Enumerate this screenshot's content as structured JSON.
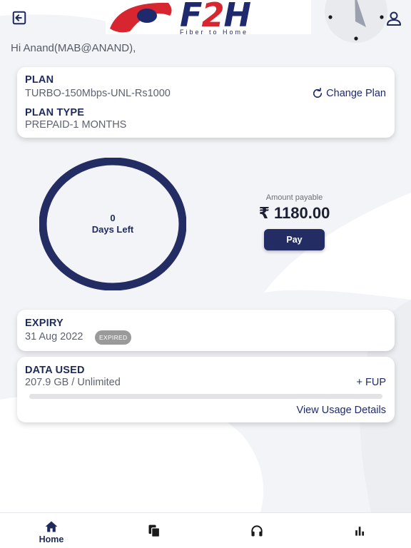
{
  "header": {
    "logo_text": "F2H",
    "logo_sub": "Fiber to Home",
    "greeting": "Hi Anand(MAB@ANAND),"
  },
  "plan": {
    "label": "PLAN",
    "name": "TURBO-150Mbps-UNL-Rs1000",
    "type_label": "PLAN TYPE",
    "type_value": "PREPAID-1 MONTHS",
    "change_plan": "Change Plan"
  },
  "days": {
    "count": "0",
    "label": "Days Left"
  },
  "payment": {
    "amount_label": "Amount payable",
    "amount": "₹ 1180.00",
    "pay_label": "Pay"
  },
  "expiry": {
    "label": "EXPIRY",
    "date": "31 Aug 2022",
    "badge": "EXPIRED"
  },
  "data_usage": {
    "label": "DATA USED",
    "value": "207.9 GB / Unlimited",
    "fup": "+ FUP",
    "progress_fraction": 0,
    "details_link": "View Usage Details"
  },
  "bottom_nav": {
    "home": "Home"
  },
  "colors": {
    "primary": "#232d63",
    "brand_red": "#d7262f",
    "background": "#f3f4f7",
    "badge_gray": "#9a9a9a"
  },
  "icons": {
    "logout": "logout-icon",
    "profile": "user-icon",
    "change_plan": "refresh-icon",
    "home": "home-icon",
    "documents": "copy-icon",
    "support": "headset-icon",
    "stats": "bar-chart-icon"
  }
}
